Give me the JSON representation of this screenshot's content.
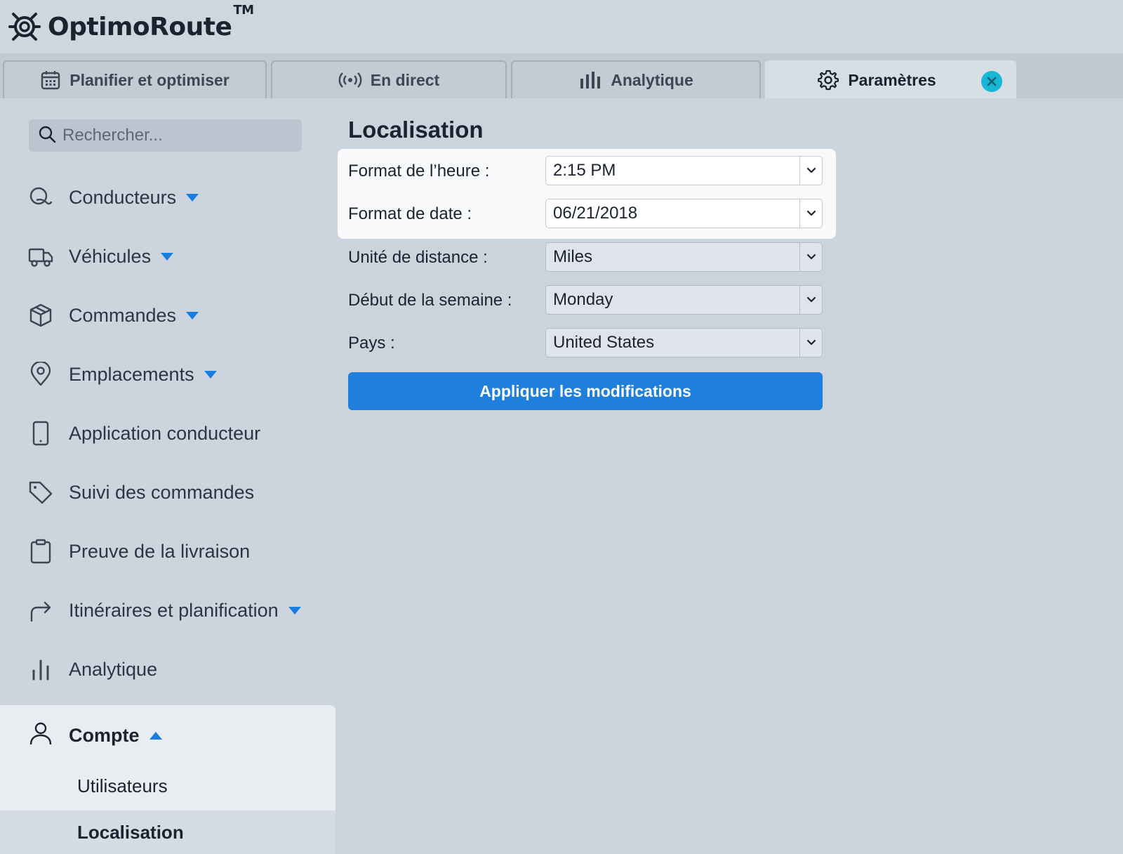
{
  "app": {
    "name": "OptimoRoute",
    "trademark": "TM"
  },
  "tabs": [
    {
      "label": "Planifier et optimiser",
      "icon": "calendar-icon",
      "active": false
    },
    {
      "label": "En direct",
      "icon": "broadcast-icon",
      "active": false
    },
    {
      "label": "Analytique",
      "icon": "bar-chart-icon",
      "active": false
    },
    {
      "label": "Paramètres",
      "icon": "gear-icon",
      "active": true
    }
  ],
  "sidebar": {
    "search_placeholder": "Rechercher...",
    "items": [
      {
        "label": "Conducteurs",
        "icon": "driver-icon",
        "expandable": true
      },
      {
        "label": "Véhicules",
        "icon": "truck-icon",
        "expandable": true
      },
      {
        "label": "Commandes",
        "icon": "box-icon",
        "expandable": true
      },
      {
        "label": "Emplacements",
        "icon": "location-pin-icon",
        "expandable": true
      },
      {
        "label": "Application conducteur",
        "icon": "phone-icon",
        "expandable": false
      },
      {
        "label": "Suivi des commandes",
        "icon": "tag-icon",
        "expandable": false
      },
      {
        "label": "Preuve de la livraison",
        "icon": "clipboard-icon",
        "expandable": false
      },
      {
        "label": "Itinéraires et planification",
        "icon": "route-arrow-icon",
        "expandable": true
      },
      {
        "label": "Analytique",
        "icon": "bar-chart-icon",
        "expandable": false
      }
    ],
    "account": {
      "label": "Compte",
      "icon": "user-icon",
      "sub_items": [
        {
          "label": "Utilisateurs",
          "active": false
        },
        {
          "label": "Localisation",
          "active": true
        }
      ]
    }
  },
  "main": {
    "title": "Localisation",
    "fields": [
      {
        "label": "Format de l’heure :",
        "value": "2:15 PM"
      },
      {
        "label": "Format de date :",
        "value": "06/21/2018"
      },
      {
        "label": "Unité de distance :",
        "value": "Miles"
      },
      {
        "label": "Début de la semaine :",
        "value": "Monday"
      },
      {
        "label": "Pays :",
        "value": "United States"
      }
    ],
    "apply_label": "Appliquer les modifications"
  },
  "colors": {
    "accent": "#1f7fdd",
    "close_button": "#19b7d6",
    "background": "#cbd3dc"
  }
}
